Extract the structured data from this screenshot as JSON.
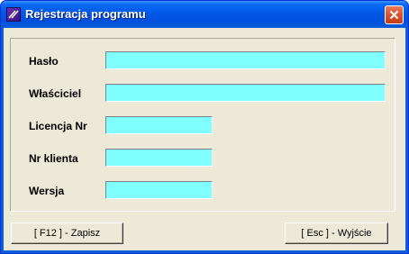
{
  "window": {
    "title": "Rejestracja programu",
    "icon": "app-logo-icon",
    "close_icon": "close-icon",
    "accent": "#0a5fd8"
  },
  "form": {
    "field_color": "#80ffff",
    "fields": [
      {
        "label": "Hasło",
        "value": ""
      },
      {
        "label": "Właściciel",
        "value": ""
      },
      {
        "label": "Licencja Nr",
        "value": ""
      },
      {
        "label": "Nr klienta",
        "value": ""
      },
      {
        "label": "Wersja",
        "value": ""
      }
    ]
  },
  "buttons": {
    "save": "[ F12 ] - Zapisz",
    "exit": "[ Esc ] - Wyjście"
  }
}
